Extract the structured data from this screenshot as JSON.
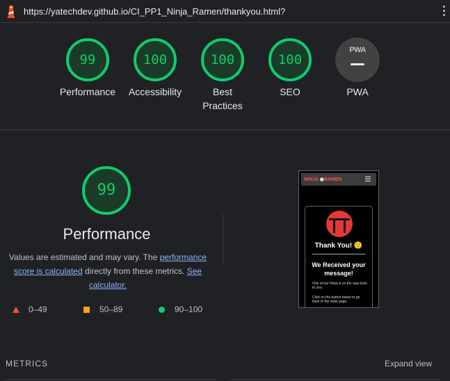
{
  "header": {
    "url": "https://yatechdev.github.io/CI_PP1_Ninja_Ramen/thankyou.html?",
    "logo_icon": "lighthouse-icon",
    "menu_icon": "kebab-menu-icon"
  },
  "scores": [
    {
      "score": "99",
      "label": "Performance"
    },
    {
      "score": "100",
      "label": "Accessibility"
    },
    {
      "score": "100",
      "label": "Best Practices"
    },
    {
      "score": "100",
      "label": "SEO"
    }
  ],
  "pwa": {
    "badge": "PWA",
    "label": "PWA"
  },
  "performance": {
    "score": "99",
    "title": "Performance",
    "desc_1": "Values are estimated and may vary. The ",
    "link_1": "performance score is calculated",
    "desc_2": " directly from these metrics. ",
    "link_2": "See calculator."
  },
  "legend": [
    {
      "range": "0–49",
      "icon": "fail-triangle-icon"
    },
    {
      "range": "50–89",
      "icon": "average-square-icon"
    },
    {
      "range": "90–100",
      "icon": "pass-circle-icon"
    }
  ],
  "screenshot": {
    "brand_left": "NINJA",
    "brand_right": "RAMEN",
    "heading": "Thank You! 🙂",
    "subheading": "We Received your message!",
    "para_1": "One of our Ninja is on the way back to you.",
    "para_2": "Click on the button below to go back to the main page."
  },
  "footer": {
    "metrics_label": "METRICS",
    "expand_label": "Expand view"
  },
  "colors": {
    "pass": "#0cce6b",
    "average": "#ffa400",
    "fail": "#ff4e42",
    "background": "#202124"
  }
}
